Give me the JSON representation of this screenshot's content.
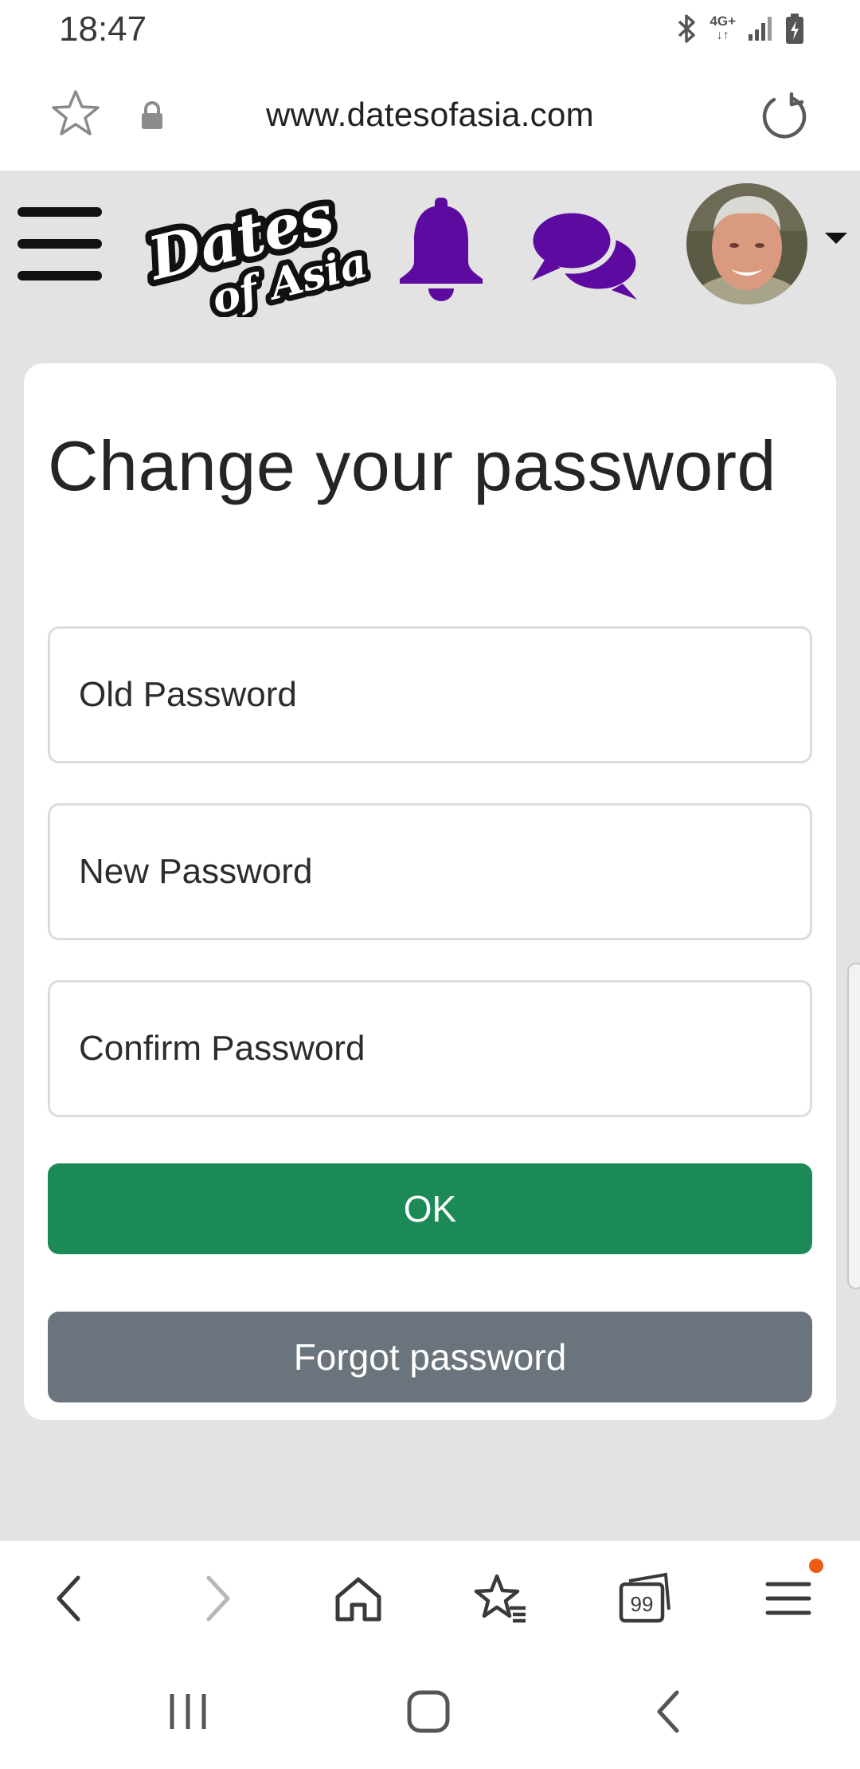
{
  "status_bar": {
    "time": "18:47",
    "network": "4G+"
  },
  "browser": {
    "url": "www.datesofasia.com"
  },
  "site": {
    "logo_text": "Dates of Asia"
  },
  "form": {
    "title": "Change your password",
    "old_password": {
      "placeholder": "Old Password",
      "value": ""
    },
    "new_password": {
      "placeholder": "New Password",
      "value": ""
    },
    "confirm_password": {
      "placeholder": "Confirm Password",
      "value": ""
    },
    "ok_label": "OK",
    "forgot_label": "Forgot password"
  },
  "toolbar": {
    "tabs_count": "99"
  },
  "colors": {
    "accent_purple": "#5c0aa0",
    "ok_green": "#1b8a57",
    "forgot_gray": "#6b737d",
    "page_bg": "#e3e3e3",
    "notification_dot": "#ec5b14"
  },
  "icons": [
    "bluetooth-icon",
    "signal-icon",
    "battery-icon",
    "star-icon",
    "lock-icon",
    "reload-icon",
    "hamburger-menu-icon",
    "bell-icon",
    "chat-icon",
    "back-icon",
    "forward-icon",
    "home-icon",
    "bookmarks-icon",
    "tabs-icon",
    "menu-icon"
  ]
}
